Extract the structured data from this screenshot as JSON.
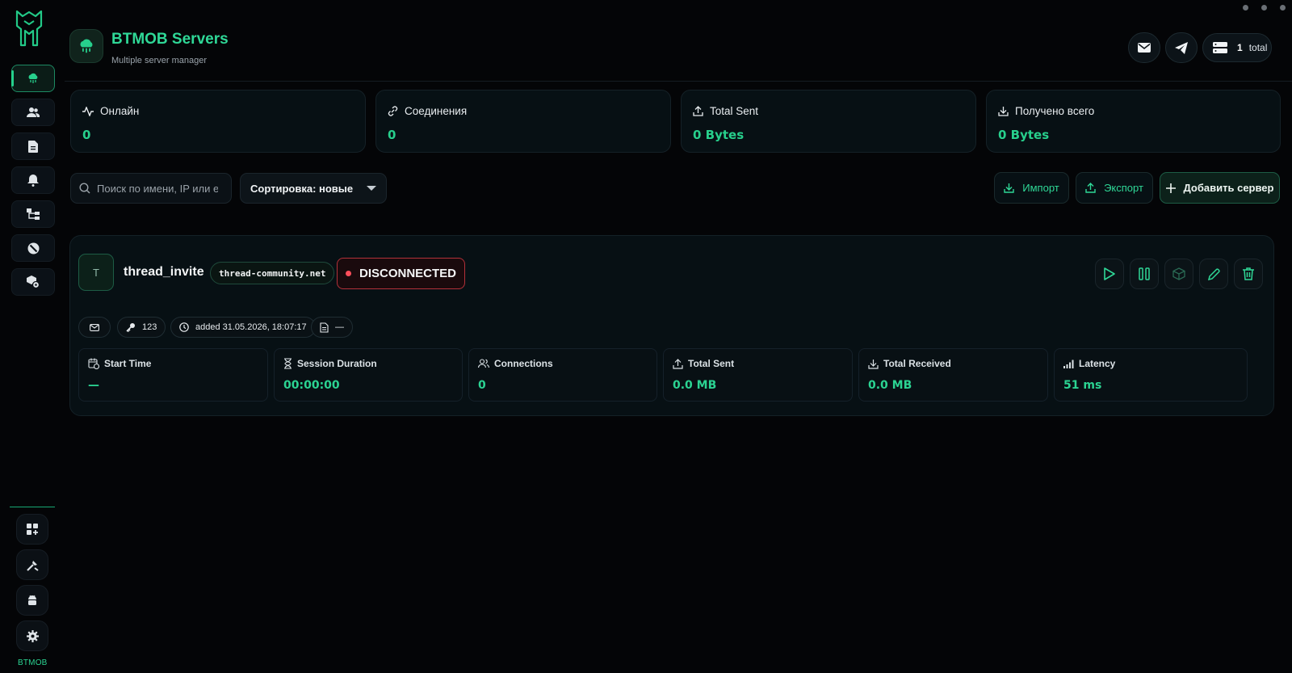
{
  "app": {
    "title": "BTMOB Servers",
    "subtitle": "Multiple server manager",
    "brand": "BTMOB",
    "accent": "#27cf8c"
  },
  "header": {
    "total_count": "1",
    "total_label": "total"
  },
  "sidebar": {
    "items": [
      {
        "icon": "cloud-icon",
        "active": true
      },
      {
        "icon": "users-icon"
      },
      {
        "icon": "document-icon"
      },
      {
        "icon": "bell-icon"
      },
      {
        "icon": "sitemap-icon"
      },
      {
        "icon": "ban-icon"
      },
      {
        "icon": "box-settings-icon"
      }
    ],
    "bottom": [
      {
        "icon": "apps-icon"
      },
      {
        "icon": "tools-icon"
      },
      {
        "icon": "android-icon"
      },
      {
        "icon": "gear-icon"
      }
    ]
  },
  "stats": [
    {
      "label": "Онлайн",
      "value": "0",
      "icon": "activity-icon"
    },
    {
      "label": "Соединения",
      "value": "0",
      "icon": "link-icon"
    },
    {
      "label": "Total Sent",
      "value": "0 Bytes",
      "icon": "upload-icon"
    },
    {
      "label": "Получено всего",
      "value": "0 Bytes",
      "icon": "download-icon"
    }
  ],
  "toolbar": {
    "search_placeholder": "Поиск по имени, IP или е",
    "sort_label": "Сортировка: новые",
    "import_label": "Импорт",
    "export_label": "Экспорт",
    "add_label": "Добавить сервер"
  },
  "server": {
    "initial": "T",
    "name": "thread_invite",
    "host": "thread-community.net",
    "status": "DISCONNECTED",
    "status_color": "#ff4e5b",
    "chips": {
      "key": "123",
      "added": "added 31.05.2026, 18:07:17",
      "doc": "—"
    },
    "metrics": [
      {
        "label": "Start Time",
        "value": "—",
        "icon": "calendar-clock-icon"
      },
      {
        "label": "Session Duration",
        "value": "00:00:00",
        "icon": "hourglass-icon"
      },
      {
        "label": "Connections",
        "value": "0",
        "icon": "users-icon"
      },
      {
        "label": "Total Sent",
        "value": "0.0 MB",
        "icon": "upload-icon"
      },
      {
        "label": "Total Received",
        "value": "0.0 MB",
        "icon": "download-icon"
      },
      {
        "label": "Latency",
        "value": "51 ms",
        "icon": "signal-icon"
      }
    ]
  }
}
